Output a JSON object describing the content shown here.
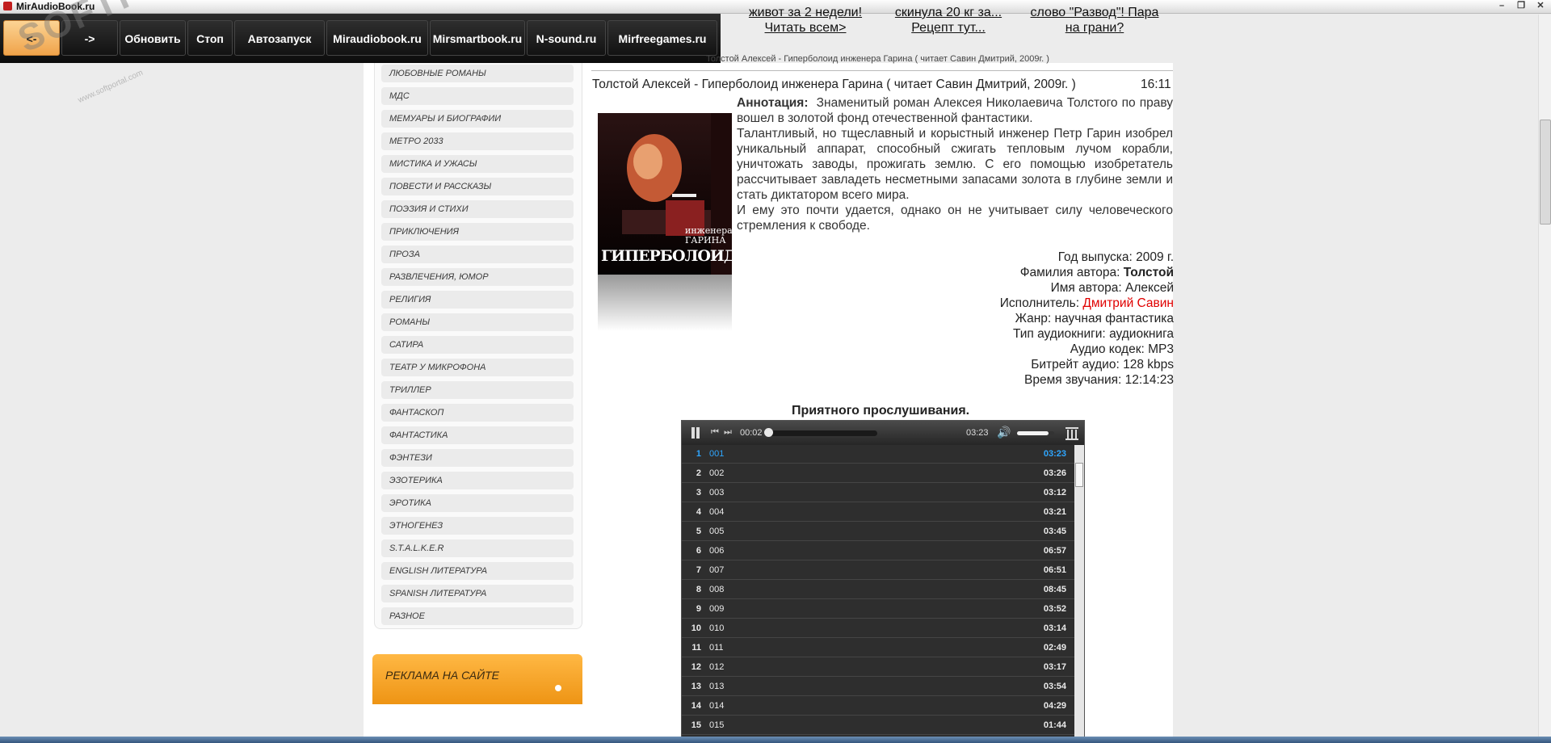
{
  "window": {
    "title": "MirAudioBook.ru",
    "minimize": "–",
    "maximize": "❐",
    "close": "✕"
  },
  "toolbar": {
    "back": "<-",
    "forward": "->",
    "refresh": "Обновить",
    "stop": "Стоп",
    "autorun": "Автозапуск",
    "links": [
      "Miraudiobook.ru",
      "Mirsmartbook.ru",
      "N-sound.ru",
      "Mirfreegames.ru"
    ]
  },
  "watermark": {
    "text": "SOFTPORTAL",
    "sub": "www.softportal.com"
  },
  "news": [
    [
      "живот за 2 недели!",
      "Читать всем>"
    ],
    [
      "скинула 20 кг за...",
      "Рецепт тут..."
    ],
    [
      "слово \"Развод\"! Пара",
      "на грани?"
    ]
  ],
  "breadcrumb": "Толстой Алексей - Гиперболоид инженера Гарина ( читает Савин Дмитрий, 2009г. )",
  "sidebar": {
    "categories": [
      "ЛЮБОВНЫЕ РОМАНЫ",
      "МДС",
      "МЕМУАРЫ И БИОГРАФИИ",
      "МЕТРО 2033",
      "МИСТИКА И УЖАСЫ",
      "ПОВЕСТИ И РАССКАЗЫ",
      "ПОЭЗИЯ И СТИХИ",
      "ПРИКЛЮЧЕНИЯ",
      "ПРОЗА",
      "РАЗВЛЕЧЕНИЯ, ЮМОР",
      "РЕЛИГИЯ",
      "РОМАНЫ",
      "САТИРА",
      "ТЕАТР У МИКРОФОНА",
      "ТРИЛЛЕР",
      "ФАНТАСКОП",
      "ФАНТАСТИКА",
      "ФЭНТЕЗИ",
      "ЭЗОТЕРИКА",
      "ЭРОТИКА",
      "ЭТНОГЕНЕЗ",
      "S.T.A.L.K.E.R",
      "ENGLISH ЛИТЕРАТУРА",
      "SPANISH ЛИТЕРАТУРА",
      "РАЗНОЕ"
    ],
    "ad_label": "РЕКЛАМА НА САЙТЕ"
  },
  "book": {
    "title": "Толстой Алексей - Гиперболоид инженера Гарина ( читает Савин Дмитрий, 2009г. )",
    "time": "16:11",
    "cover": {
      "title": "ГИПЕРБОЛОИД",
      "subtitle": "инженера ГАРИНА"
    },
    "annotation_label": "Аннотация:",
    "annotation": [
      "Знаменитый роман Алексея Николаевича Толстого по праву вошел в золотой фонд отечественной фантастики.",
      "Талантливый, но тщеславный и корыстный инженер Петр Гарин изобрел уникальный аппарат, способный сжигать тепловым лучом корабли, уничтожать заводы, прожигать землю. С его помощью изобретатель рассчитывает завладеть несметными запасами золота в глубине земли и стать диктатором всего мира.",
      "И ему это почти удается, однако он не учитывает силу человеческого стремления к свободе."
    ],
    "meta": {
      "year_label": "Год выпуска:",
      "year": "2009 г.",
      "surname_label": "Фамилия автора:",
      "surname": "Толстой",
      "name_label": "Имя автора:",
      "name": "Алексей",
      "performer_label": "Исполнитель:",
      "performer": "Дмитрий Савин",
      "genre_label": "Жанр:",
      "genre": "научная фантастика",
      "type_label": "Тип аудиокниги:",
      "type": "аудиокнига",
      "codec_label": "Аудио кодек:",
      "codec": "MP3",
      "bitrate_label": "Битрейт аудио:",
      "bitrate": "128 kbps",
      "duration_label": "Время звучания:",
      "duration": "12:14:23"
    },
    "greeting": "Приятного прослушивания."
  },
  "player": {
    "current": "00:02",
    "total": "03:23",
    "progress": 0.01,
    "volume": 0.85,
    "tracks": [
      {
        "n": "1",
        "name": "001",
        "dur": "03:23"
      },
      {
        "n": "2",
        "name": "002",
        "dur": "03:26"
      },
      {
        "n": "3",
        "name": "003",
        "dur": "03:12"
      },
      {
        "n": "4",
        "name": "004",
        "dur": "03:21"
      },
      {
        "n": "5",
        "name": "005",
        "dur": "03:45"
      },
      {
        "n": "6",
        "name": "006",
        "dur": "06:57"
      },
      {
        "n": "7",
        "name": "007",
        "dur": "06:51"
      },
      {
        "n": "8",
        "name": "008",
        "dur": "08:45"
      },
      {
        "n": "9",
        "name": "009",
        "dur": "03:52"
      },
      {
        "n": "10",
        "name": "010",
        "dur": "03:14"
      },
      {
        "n": "11",
        "name": "011",
        "dur": "02:49"
      },
      {
        "n": "12",
        "name": "012",
        "dur": "03:17"
      },
      {
        "n": "13",
        "name": "013",
        "dur": "03:54"
      },
      {
        "n": "14",
        "name": "014",
        "dur": "04:29"
      },
      {
        "n": "15",
        "name": "015",
        "dur": "01:44"
      }
    ]
  },
  "colors": {
    "accent_orange": "#f0a34a",
    "active_track": "#2ea6ff",
    "performer": "#e00000"
  }
}
